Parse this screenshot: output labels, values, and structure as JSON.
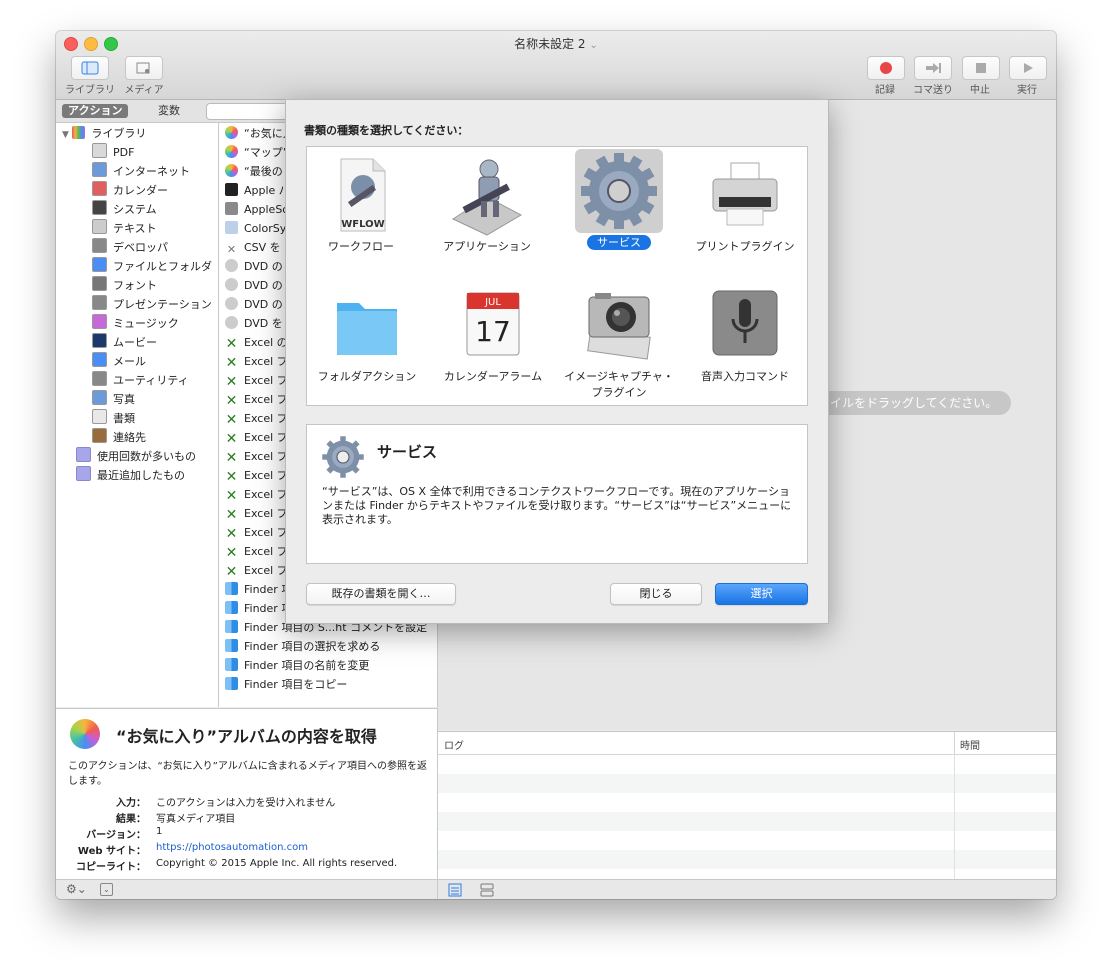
{
  "window": {
    "title": "名称未設定 2",
    "toolbar": {
      "library_label": "ライブラリ",
      "media_label": "メディア",
      "record_label": "記録",
      "step_label": "コマ送り",
      "stop_label": "中止",
      "run_label": "実行"
    },
    "accent_color": "#1a74e4"
  },
  "left_tabs": {
    "actions": "アクション",
    "variables": "変数"
  },
  "library": {
    "root": "ライブラリ",
    "items": [
      "PDF",
      "インターネット",
      "カレンダー",
      "システム",
      "テキスト",
      "デベロッパ",
      "ファイルとフォルダ",
      "フォント",
      "プレゼンテーション",
      "ミュージック",
      "ムービー",
      "メール",
      "ユーティリティ",
      "写真",
      "書類",
      "連絡先"
    ],
    "smart": [
      "使用回数が多いもの",
      "最近追加したもの"
    ]
  },
  "actions": [
    "“お気に入",
    "“マップ”",
    "“最後の",
    "Apple パ",
    "AppleSc",
    "ColorSy",
    "CSV を",
    "DVD の",
    "DVD の",
    "DVD の",
    "DVD を",
    "Excel の",
    "Excel フ",
    "Excel フ",
    "Excel プ",
    "Excel プ",
    "Excel プ",
    "Excel プ",
    "Excel プ",
    "Excel プ",
    "Excel プ",
    "Excel プ",
    "Excel プ",
    "Excel プ",
    "Finder 項",
    "Finder 項目にラベルを割り当てる",
    "Finder 項目の S...ht コメントを設定",
    "Finder 項目の選択を求める",
    "Finder 項目の名前を変更",
    "Finder 項目をコピー"
  ],
  "description": {
    "title": "“お気に入り”アルバムの内容を取得",
    "text": "このアクションは、“お気に入り”アルバムに含まれるメディア項目への参照を返します。",
    "fields": [
      {
        "key": "入力：",
        "value": "このアクションは入力を受け入れません"
      },
      {
        "key": "結果：",
        "value": "写真メディア項目"
      },
      {
        "key": "バージョン：",
        "value": "1"
      },
      {
        "key": "Web サイト：",
        "value": "https://photosautomation.com"
      },
      {
        "key": "コピーライト：",
        "value": "Copyright © 2015 Apple Inc. All rights reserved."
      }
    ]
  },
  "workflow_hint": "イルをドラッグしてください。",
  "log": {
    "col_log": "ログ",
    "col_time": "時間"
  },
  "sheet": {
    "prompt": "書類の種類を選択してください：",
    "types": [
      {
        "label": "ワークフロー",
        "icon": "wflow-document-icon",
        "selected": false
      },
      {
        "label": "アプリケーション",
        "icon": "automator-robot-icon",
        "selected": false
      },
      {
        "label": "サービス",
        "icon": "gear-icon",
        "selected": true
      },
      {
        "label": "プリントプラグイン",
        "icon": "printer-icon",
        "selected": false
      },
      {
        "label": "フォルダアクション",
        "icon": "folder-icon",
        "selected": false
      },
      {
        "label": "カレンダーアラーム",
        "icon": "calendar-icon",
        "selected": false
      },
      {
        "label": "イメージキャプチャ・プラグイン",
        "icon": "camera-icon",
        "selected": false
      },
      {
        "label": "音声入力コマンド",
        "icon": "microphone-icon",
        "selected": false
      }
    ],
    "wflow_badge": "WFLOW",
    "calendar_month": "JUL",
    "calendar_day": "17",
    "info_title": "サービス",
    "info_text": "“サービス”は、OS X 全体で利用できるコンテクストワークフローです。現在のアプリケーションまたは Finder からテキストやファイルを受け取ります。“サービス”は“サービス”メニューに表示されます。",
    "open_existing": "既存の書類を開く…",
    "close": "閉じる",
    "choose": "選択"
  }
}
